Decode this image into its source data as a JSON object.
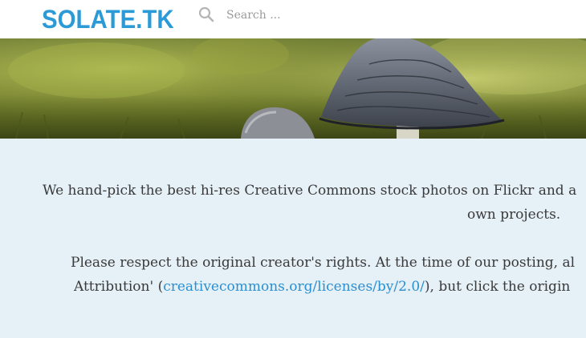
{
  "header": {
    "logo": "SOLATE.TK",
    "search_placeholder": "Search ..."
  },
  "hero": {
    "image_icon": "mushroom-photo"
  },
  "intro": {
    "line1": "We hand-pick the best hi-res Creative Commons stock photos on Flickr and a",
    "line2": "own projects."
  },
  "rights": {
    "line1": "Please respect the original creator's rights. At the time of our posting, al",
    "line2_prefix": "Attribution' (",
    "link": "creativecommons.org/licenses/by/2.0/",
    "line2_suffix": "), but click the origin"
  },
  "colors": {
    "brand": "#2b9ad6",
    "link": "#2b8fd0",
    "background": "#e6f0f7"
  }
}
